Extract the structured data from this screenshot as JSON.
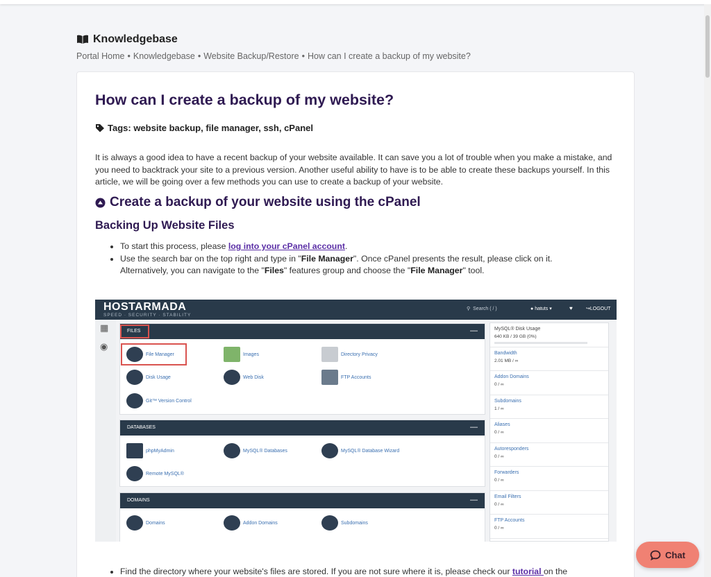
{
  "header": {
    "title": "Knowledgebase",
    "icon": "book-icon"
  },
  "breadcrumb": [
    "Portal Home",
    "Knowledgebase",
    "Website Backup/Restore",
    "How can I create a backup of my website?"
  ],
  "article": {
    "title": "How can I create a backup of my website?",
    "tags_label": "Tags: website backup, file manager, ssh, cPanel",
    "intro": "It is always a good idea to have a recent backup of your website available. It can save you a lot of trouble when you make a mistake, and you need to backtrack your site to a previous version. Another useful ability to have is to be able to create these backups yourself. In this article, we will be going over a few methods you can use to create a backup of your website.",
    "section_title": "Create a backup of your website using the cPanel",
    "subsection_title": "Backing Up Website Files",
    "step1_prefix": "To start this process, please ",
    "step1_link": "log into your cPanel account",
    "step1_suffix": ".",
    "step2_a": "Use the search bar on the top right and type in \"",
    "step2_b": "File Manager",
    "step2_c": "\". Once cPanel presents the result, please click on it. Alternatively, you can navigate to the \"",
    "step2_d": "Files",
    "step2_e": "\" features group and choose the \"",
    "step2_f": "File Manager",
    "step2_g": "\" tool.",
    "step3_prefix": "Find the directory where your website's files are stored. If you are not sure where it is, please check our ",
    "step3_link": "tutorial ",
    "step3_suffix": "on the"
  },
  "cpanel": {
    "logo": "HOSTARMADA",
    "tagline": "SPEED · SECURITY · STABILITY",
    "search_placeholder": "Search ( / )",
    "user": "hatuts",
    "logout": "LOGOUT",
    "files": {
      "header": "FILES",
      "tools": [
        "File Manager",
        "Images",
        "Directory Privacy",
        "Disk Usage",
        "Web Disk",
        "FTP Accounts",
        "Git™ Version Control"
      ]
    },
    "databases": {
      "header": "DATABASES",
      "tools": [
        "phpMyAdmin",
        "MySQL® Databases",
        "MySQL® Database Wizard",
        "Remote MySQL®"
      ]
    },
    "domains": {
      "header": "DOMAINS",
      "tools": [
        "Domains",
        "Addon Domains",
        "Subdomains"
      ]
    },
    "stats": [
      {
        "label": "MySQL® Disk Usage",
        "value": "640 KB / 39 GB   (0%)"
      },
      {
        "label": "Bandwidth",
        "value": "2.01 MB / ∞"
      },
      {
        "label": "Addon Domains",
        "value": "0 / ∞"
      },
      {
        "label": "Subdomains",
        "value": "1 / ∞"
      },
      {
        "label": "Aliases",
        "value": "0 / ∞"
      },
      {
        "label": "Autoresponders",
        "value": "0 / ∞"
      },
      {
        "label": "Forwarders",
        "value": "0 / ∞"
      },
      {
        "label": "Email Filters",
        "value": "0 / ∞"
      },
      {
        "label": "FTP Accounts",
        "value": "0 / ∞"
      }
    ]
  },
  "chat": {
    "label": "Chat"
  },
  "colors": {
    "accent": "#2f1a52",
    "link": "#5b2fa6",
    "chat": "#f08173",
    "cpanel_dark": "#293a4a"
  }
}
